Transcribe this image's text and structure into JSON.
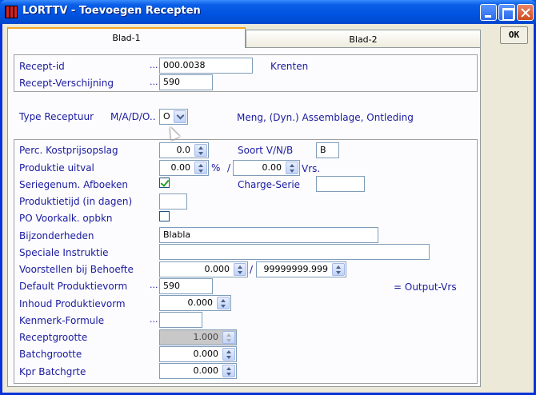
{
  "window": {
    "title": "LORTTV - Toevoegen Recepten"
  },
  "toolbar": {
    "ok_label": "OK"
  },
  "tabs": [
    {
      "label": "Blad-1"
    },
    {
      "label": "Blad-2"
    }
  ],
  "header": {
    "recept_id": {
      "label": "Recept-id",
      "value": "000.0038",
      "description": "Krenten"
    },
    "recept_verschijning": {
      "label": "Recept-Verschijning",
      "value": "590"
    }
  },
  "type_receptuur": {
    "label": "Type Receptuur",
    "sublabel": "M/A/D/O..",
    "value": "O",
    "description": "Meng, (Dyn.) Assemblage, Ontleding"
  },
  "form": {
    "perc_kostprijsopslag": {
      "label": "Perc. Kostprijsopslag",
      "value": "0.0"
    },
    "soort_vnb": {
      "label": "Soort V/N/B",
      "value": "B"
    },
    "produktie_uitval": {
      "label": "Produktie uitval",
      "value_pct": "0.00",
      "pct_sign": "%",
      "slash": "/",
      "value_vrs": "0.00",
      "vrs_unit": "Vrs."
    },
    "seriegenum_afboeken": {
      "label": "Seriegenum. Afboeken",
      "checked": true
    },
    "charge_serie": {
      "label": "Charge-Serie",
      "value": ""
    },
    "produktietijd": {
      "label": "Produktietijd (in dagen)",
      "value": ""
    },
    "po_voorkalk": {
      "label": "PO Voorkalk. opbkn",
      "checked": false
    },
    "bijzonderheden": {
      "label": "Bijzonderheden",
      "value": "Blabla"
    },
    "speciale_instructie": {
      "label": "Speciale Instruktie",
      "value": ""
    },
    "voorstellen_bij_behoefte": {
      "label": "Voorstellen bij Behoefte",
      "value_min": "0.000",
      "slash": "/",
      "value_max": "99999999.999"
    },
    "default_produktievorm": {
      "label": "Default Produktievorm",
      "value": "590",
      "description": "=  Output-Vrs"
    },
    "inhoud_produktievorm": {
      "label": "Inhoud Produktievorm",
      "value": "0.000"
    },
    "kenmerk_formule": {
      "label": "Kenmerk-Formule",
      "value": ""
    },
    "receptgrootte": {
      "label": "Receptgrootte",
      "value": "1.000"
    },
    "batchgrootte": {
      "label": "Batchgrootte",
      "value": "0.000"
    },
    "kpr_batchgrte": {
      "label": "Kpr Batchgrte",
      "value": "0.000"
    }
  },
  "colors": {
    "label_blue": "#1a1aa0",
    "title_blue": "#0054e3",
    "tab_accent": "#f6a623"
  }
}
